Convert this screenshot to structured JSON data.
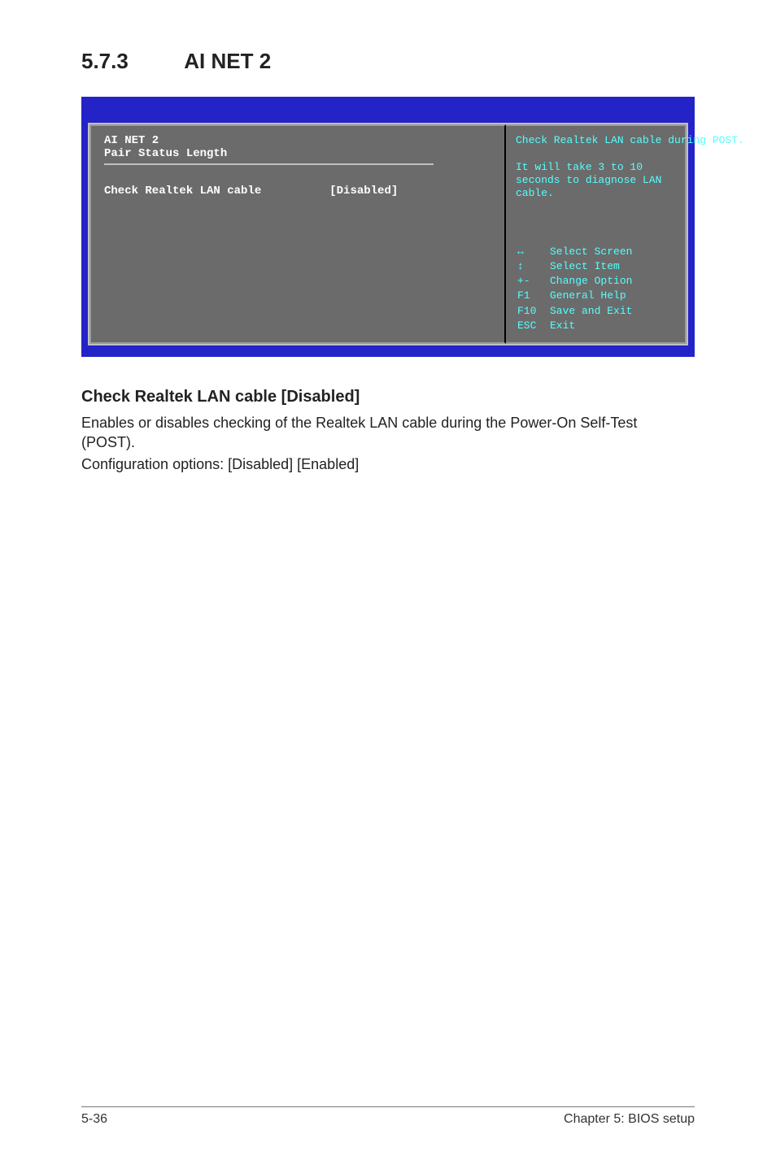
{
  "section": {
    "number": "5.7.3",
    "title": "AI NET 2"
  },
  "bios": {
    "left": {
      "header_line1": "AI NET 2",
      "header_line2": "Pair   Status    Length",
      "option_label": "Check Realtek LAN cable",
      "option_value": "[Disabled]"
    },
    "right": {
      "help1": "Check Realtek LAN cable during POST.",
      "help2": "It will take 3 to 10 seconds to diagnose LAN cable.",
      "nav": [
        {
          "key": "↔",
          "label": "Select Screen"
        },
        {
          "key": "↕",
          "label": "Select Item"
        },
        {
          "key": "+-",
          "label": "Change Option"
        },
        {
          "key": "F1",
          "label": "General Help"
        },
        {
          "key": "F10",
          "label": "Save and Exit"
        },
        {
          "key": "ESC",
          "label": "Exit"
        }
      ]
    }
  },
  "subheading": "Check Realtek LAN cable [Disabled]",
  "body": {
    "p1": "Enables or disables checking of the Realtek LAN cable during the Power-On Self-Test (POST).",
    "p2": "Configuration options: [Disabled] [Enabled]"
  },
  "footer": {
    "left": "5-36",
    "right": "Chapter 5: BIOS setup"
  }
}
